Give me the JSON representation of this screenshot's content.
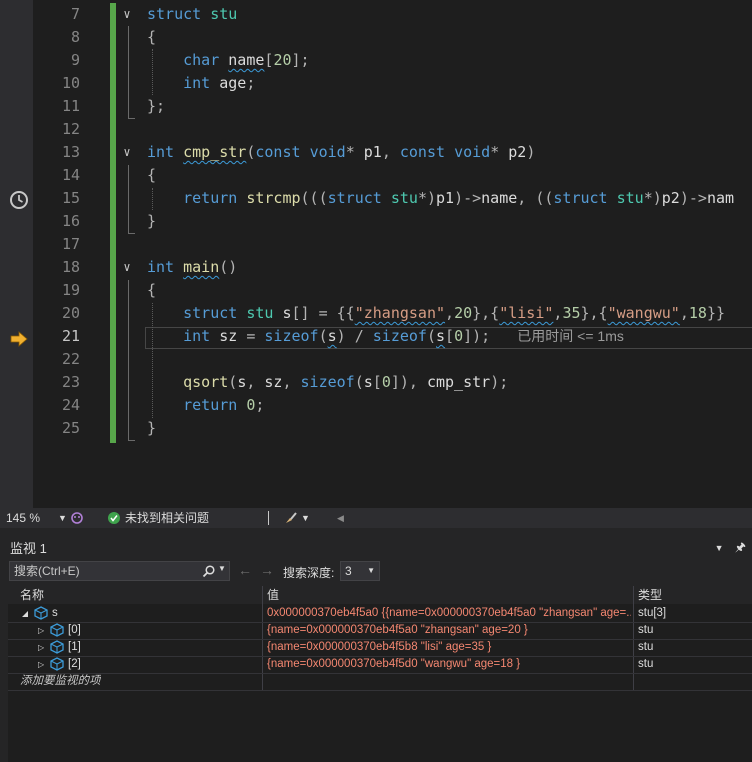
{
  "editor": {
    "lines": [
      {
        "n": "7",
        "fold": "∨",
        "tokens": [
          {
            "c": "kw",
            "t": "struct"
          },
          {
            "c": "id",
            "t": " "
          },
          {
            "c": "ty",
            "t": "stu"
          }
        ]
      },
      {
        "n": "8",
        "tokens": [
          {
            "c": "pu",
            "t": "{"
          }
        ]
      },
      {
        "n": "9",
        "tokens": [
          {
            "c": "id",
            "t": "    "
          },
          {
            "c": "kw",
            "t": "char"
          },
          {
            "c": "id",
            "t": " "
          },
          {
            "c": "id sq",
            "t": "name"
          },
          {
            "c": "pu",
            "t": "["
          },
          {
            "c": "nu",
            "t": "20"
          },
          {
            "c": "pu",
            "t": "];"
          }
        ]
      },
      {
        "n": "10",
        "tokens": [
          {
            "c": "id",
            "t": "    "
          },
          {
            "c": "kw",
            "t": "int"
          },
          {
            "c": "id",
            "t": " age"
          },
          {
            "c": "pu",
            "t": ";"
          }
        ]
      },
      {
        "n": "11",
        "tokens": [
          {
            "c": "pu",
            "t": "};"
          }
        ]
      },
      {
        "n": "12",
        "tokens": []
      },
      {
        "n": "13",
        "fold": "∨",
        "tokens": [
          {
            "c": "kw",
            "t": "int"
          },
          {
            "c": "id",
            "t": " "
          },
          {
            "c": "fn sq",
            "t": "cmp_str"
          },
          {
            "c": "pu",
            "t": "("
          },
          {
            "c": "kw",
            "t": "const"
          },
          {
            "c": "id",
            "t": " "
          },
          {
            "c": "kw",
            "t": "void"
          },
          {
            "c": "pu",
            "t": "*"
          },
          {
            "c": "id",
            "t": " p1"
          },
          {
            "c": "pu",
            "t": ", "
          },
          {
            "c": "kw",
            "t": "const"
          },
          {
            "c": "id",
            "t": " "
          },
          {
            "c": "kw",
            "t": "void"
          },
          {
            "c": "pu",
            "t": "*"
          },
          {
            "c": "id",
            "t": " p2"
          },
          {
            "c": "pu",
            "t": ")"
          }
        ]
      },
      {
        "n": "14",
        "tokens": [
          {
            "c": "pu",
            "t": "{"
          }
        ]
      },
      {
        "n": "15",
        "tokens": [
          {
            "c": "id",
            "t": "    "
          },
          {
            "c": "kw",
            "t": "return"
          },
          {
            "c": "id",
            "t": " "
          },
          {
            "c": "fn",
            "t": "strcmp"
          },
          {
            "c": "pu",
            "t": "((("
          },
          {
            "c": "kw",
            "t": "struct"
          },
          {
            "c": "id",
            "t": " "
          },
          {
            "c": "ty",
            "t": "stu"
          },
          {
            "c": "pu",
            "t": "*)"
          },
          {
            "c": "id",
            "t": "p1"
          },
          {
            "c": "pu",
            "t": ")->"
          },
          {
            "c": "id",
            "t": "name"
          },
          {
            "c": "pu",
            "t": ", (("
          },
          {
            "c": "kw",
            "t": "struct"
          },
          {
            "c": "id",
            "t": " "
          },
          {
            "c": "ty",
            "t": "stu"
          },
          {
            "c": "pu",
            "t": "*)"
          },
          {
            "c": "id",
            "t": "p2"
          },
          {
            "c": "pu",
            "t": ")->"
          },
          {
            "c": "id",
            "t": "nam"
          }
        ]
      },
      {
        "n": "16",
        "tokens": [
          {
            "c": "pu",
            "t": "}"
          }
        ]
      },
      {
        "n": "17",
        "tokens": []
      },
      {
        "n": "18",
        "fold": "∨",
        "tokens": [
          {
            "c": "kw",
            "t": "int"
          },
          {
            "c": "id",
            "t": " "
          },
          {
            "c": "fn sq",
            "t": "main"
          },
          {
            "c": "pu",
            "t": "()"
          }
        ]
      },
      {
        "n": "19",
        "tokens": [
          {
            "c": "pu",
            "t": "{"
          }
        ]
      },
      {
        "n": "20",
        "tokens": [
          {
            "c": "id",
            "t": "    "
          },
          {
            "c": "kw",
            "t": "struct"
          },
          {
            "c": "id",
            "t": " "
          },
          {
            "c": "ty",
            "t": "stu"
          },
          {
            "c": "id",
            "t": " s"
          },
          {
            "c": "pu",
            "t": "[] = {{"
          },
          {
            "c": "st sq",
            "t": "\"zhangsan\""
          },
          {
            "c": "pu",
            "t": ","
          },
          {
            "c": "nu",
            "t": "20"
          },
          {
            "c": "pu",
            "t": "},{"
          },
          {
            "c": "st sq",
            "t": "\"lisi\""
          },
          {
            "c": "pu",
            "t": ","
          },
          {
            "c": "nu",
            "t": "35"
          },
          {
            "c": "pu",
            "t": "},{"
          },
          {
            "c": "st sq",
            "t": "\"wangwu\""
          },
          {
            "c": "pu",
            "t": ","
          },
          {
            "c": "nu",
            "t": "18"
          },
          {
            "c": "pu",
            "t": "}}"
          }
        ]
      },
      {
        "n": "21",
        "current": true,
        "tokens": [
          {
            "c": "id",
            "t": "    "
          },
          {
            "c": "kw",
            "t": "int"
          },
          {
            "c": "id",
            "t": " sz "
          },
          {
            "c": "pu",
            "t": "= "
          },
          {
            "c": "kw",
            "t": "sizeof"
          },
          {
            "c": "pu",
            "t": "("
          },
          {
            "c": "id sq",
            "t": "s"
          },
          {
            "c": "pu",
            "t": ") / "
          },
          {
            "c": "kw",
            "t": "sizeof"
          },
          {
            "c": "pu",
            "t": "("
          },
          {
            "c": "id sq",
            "t": "s"
          },
          {
            "c": "pu",
            "t": "["
          },
          {
            "c": "nu",
            "t": "0"
          },
          {
            "c": "pu",
            "t": "]);"
          },
          {
            "c": "id",
            "t": "   "
          },
          {
            "c": "hint",
            "t": "已用时间 <= 1ms"
          }
        ]
      },
      {
        "n": "22",
        "tokens": []
      },
      {
        "n": "23",
        "tokens": [
          {
            "c": "id",
            "t": "    "
          },
          {
            "c": "fn",
            "t": "qsort"
          },
          {
            "c": "pu",
            "t": "("
          },
          {
            "c": "id",
            "t": "s"
          },
          {
            "c": "pu",
            "t": ", "
          },
          {
            "c": "id",
            "t": "sz"
          },
          {
            "c": "pu",
            "t": ", "
          },
          {
            "c": "kw",
            "t": "sizeof"
          },
          {
            "c": "pu",
            "t": "("
          },
          {
            "c": "id",
            "t": "s"
          },
          {
            "c": "pu",
            "t": "["
          },
          {
            "c": "nu",
            "t": "0"
          },
          {
            "c": "pu",
            "t": "]), "
          },
          {
            "c": "id",
            "t": "cmp_str"
          },
          {
            "c": "pu",
            "t": ");"
          }
        ]
      },
      {
        "n": "24",
        "tokens": [
          {
            "c": "id",
            "t": "    "
          },
          {
            "c": "kw",
            "t": "return"
          },
          {
            "c": "id",
            "t": " "
          },
          {
            "c": "nu",
            "t": "0"
          },
          {
            "c": "pu",
            "t": ";"
          }
        ]
      },
      {
        "n": "25",
        "tokens": [
          {
            "c": "pu",
            "t": "}"
          }
        ]
      }
    ]
  },
  "statusbar": {
    "zoom": "145 %",
    "issues": "未找到相关问题"
  },
  "watch": {
    "title": "监视 1",
    "search_placeholder": "搜索(Ctrl+E)",
    "depth_label": "搜索深度:",
    "depth_value": "3",
    "columns": {
      "name": "名称",
      "value": "值",
      "type": "类型"
    },
    "rows": [
      {
        "name": "s",
        "value": "0x000000370eb4f5a0 {{name=0x000000370eb4f5a0 \"zhangsan\" age=...",
        "type": "stu[3]",
        "expanded": true,
        "depth": 0
      },
      {
        "name": "[0]",
        "value": "{name=0x000000370eb4f5a0 \"zhangsan\" age=20 }",
        "type": "stu",
        "depth": 1
      },
      {
        "name": "[1]",
        "value": "{name=0x000000370eb4f5b8 \"lisi\" age=35 }",
        "type": "stu",
        "depth": 1
      },
      {
        "name": "[2]",
        "value": "{name=0x000000370eb4f5d0 \"wangwu\" age=18 }",
        "type": "stu",
        "depth": 1
      }
    ],
    "add_item": "添加要监视的项"
  }
}
